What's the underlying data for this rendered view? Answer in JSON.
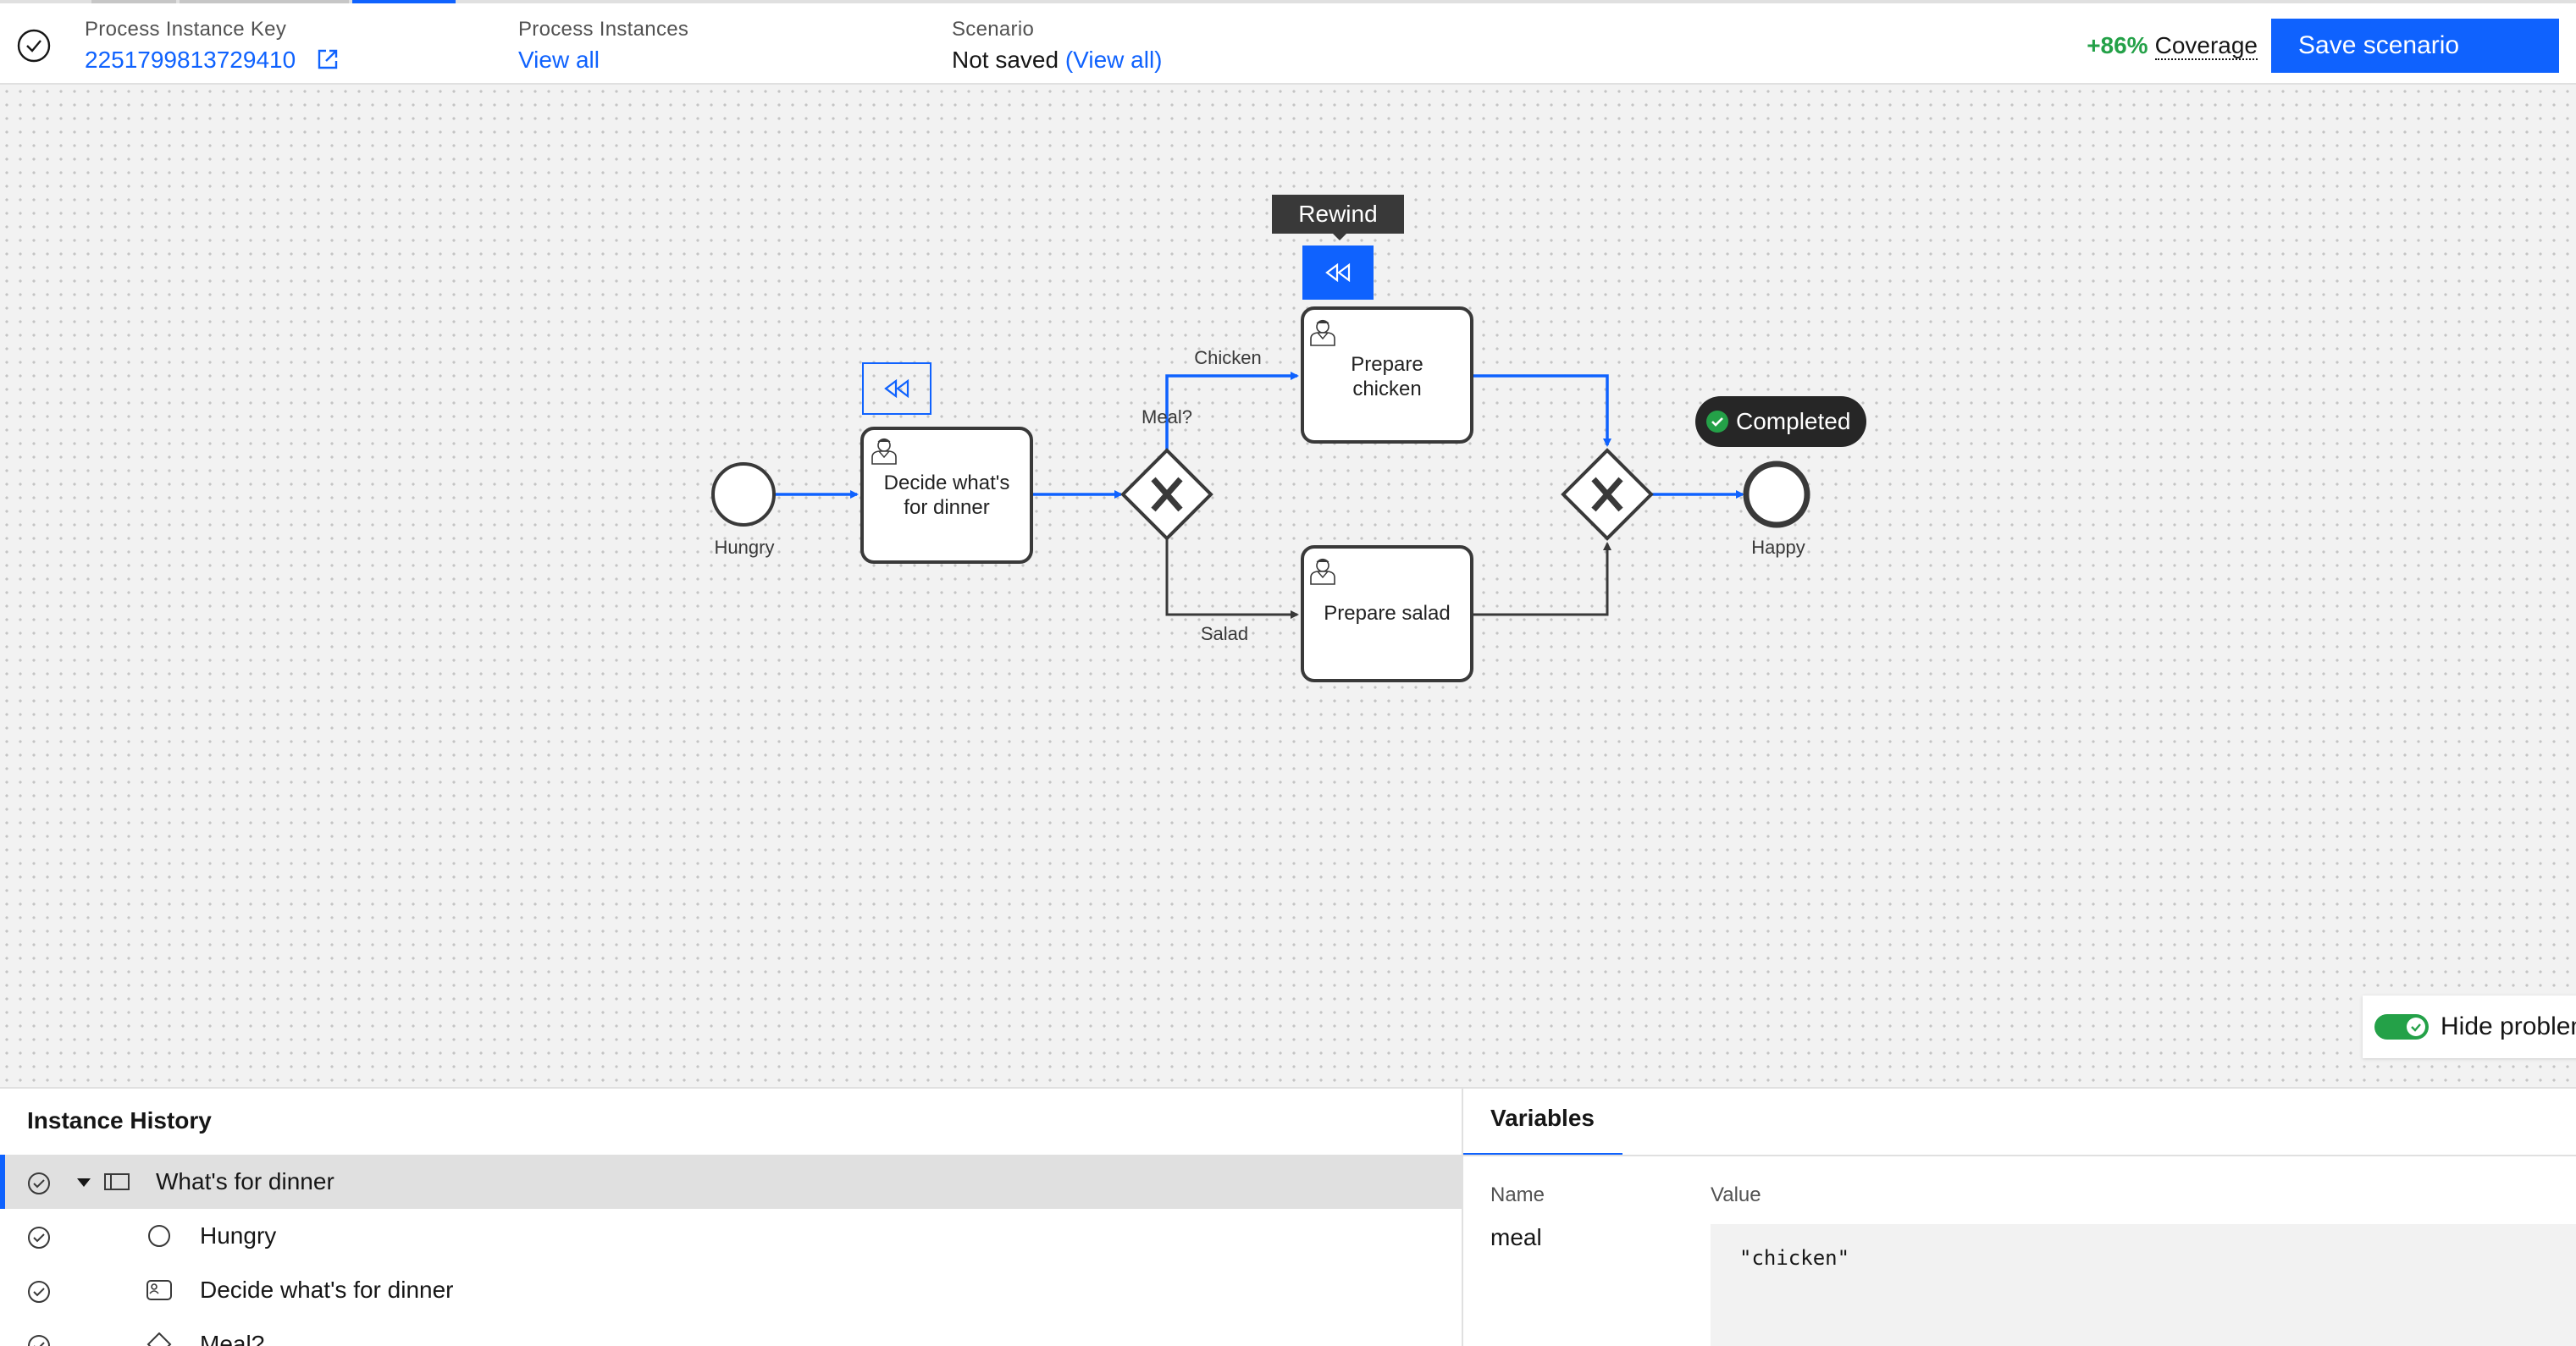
{
  "header": {
    "instance_key_label": "Process Instance Key",
    "instance_key_value": "2251799813729410",
    "process_instances_label": "Process Instances",
    "process_instances_link": "View all",
    "scenario_label": "Scenario",
    "scenario_value": "Not saved",
    "scenario_link": "(View all)",
    "coverage_pct": "+86%",
    "coverage_label": "Coverage",
    "save_button": "Save scenario"
  },
  "diagram": {
    "start_event": "Hungry",
    "task_decide_line1": "Decide what's",
    "task_decide_line2": "for dinner",
    "gateway_label": "Meal?",
    "flow_chicken": "Chicken",
    "flow_salad": "Salad",
    "task_chicken_line1": "Prepare",
    "task_chicken_line2": "chicken",
    "task_salad": "Prepare salad",
    "end_event": "Happy",
    "tooltip": "Rewind",
    "completed_badge": "Completed"
  },
  "toggle": {
    "label": "Hide problems",
    "on": true
  },
  "history": {
    "title": "Instance History",
    "rows": [
      {
        "label": "What's for dinner",
        "icon": "process-icon",
        "selected": true
      },
      {
        "label": "Hungry",
        "icon": "start-event-icon"
      },
      {
        "label": "Decide what's for dinner",
        "icon": "user-task-icon"
      },
      {
        "label": "Meal?",
        "icon": "gateway-icon"
      }
    ]
  },
  "variables": {
    "tab": "Variables",
    "name_header": "Name",
    "value_header": "Value",
    "items": [
      {
        "name": "meal",
        "value": "\"chicken\""
      }
    ]
  },
  "colors": {
    "accent": "#0f62fe",
    "success": "#24a148",
    "flow_active": "#0f62fe",
    "flow_inactive": "#393939"
  }
}
